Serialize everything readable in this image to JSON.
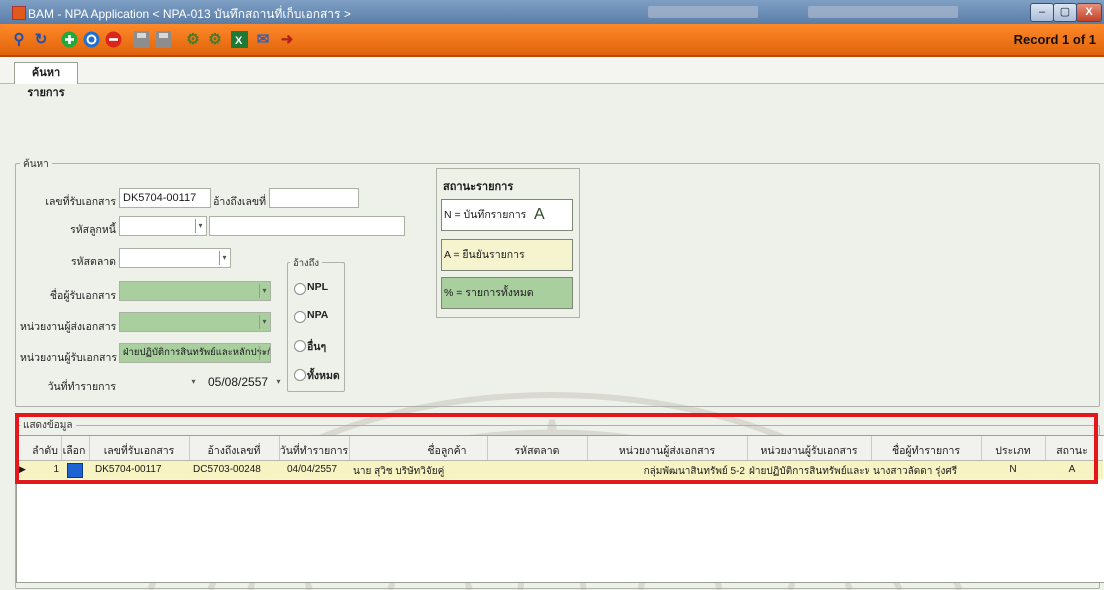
{
  "window": {
    "title": "BAM - NPA Application < NPA-013 บันทึกสถานที่เก็บเอกสาร >",
    "minimize": "–",
    "maximize": "▢",
    "close": "X"
  },
  "toolbar": {
    "icons": [
      "search-icon",
      "refresh-icon",
      "add-icon",
      "info-icon",
      "delete-icon",
      "save-icon",
      "save-all-icon",
      "settings-icon",
      "settings-cancel-icon",
      "excel-icon",
      "mail-icon",
      "exit-icon"
    ],
    "record_label": "Record 1 of 1"
  },
  "tabs": [
    {
      "label": "ค้นหารายการ"
    }
  ],
  "search": {
    "legend": "ค้นหา",
    "doc_no_label": "เลขที่รับเอกสาร",
    "doc_no_value": "DK5704-00117",
    "ref_no_label": "อ้างถึงเลขที่",
    "ref_no_value": "",
    "customer_code_label": "รหัสลูกหนี้",
    "market_code_label": "รหัสตลาด",
    "sender_label": "ชื่อผู้รับเอกสาร",
    "sender_unit_label": "หน่วยงานผู้ส่งเอกสาร",
    "receiver_unit_label": "หน่วยงานผู้รับเอกสาร",
    "receiver_unit_value": "ฝ่ายปฏิบัติการสินทรัพย์และหลักประกัน",
    "date_label": "วันที่ทำรายการ",
    "date_value": "05/08/2557"
  },
  "ref_type": {
    "legend": "อ้างถึง",
    "options": [
      "NPL",
      "NPA",
      "อื่นๆ",
      "ทั้งหมด"
    ]
  },
  "status": {
    "legend": "สถานะรายการ",
    "items": [
      {
        "label": "N = บันทึกรายการ",
        "value": "A"
      },
      {
        "label": "A = ยืนยันรายการ",
        "value": ""
      },
      {
        "label": "% = รายการทั้งหมด",
        "value": ""
      }
    ]
  },
  "results": {
    "legend": "แสดงข้อมูล",
    "columns": [
      "ลำดับ",
      "เลือก",
      "เลขที่รับเอกสาร",
      "อ้างถึงเลขที่",
      "วันที่ทำรายการ",
      "ชื่อลูกค้า",
      "รหัสตลาด",
      "หน่วยงานผู้ส่งเอกสาร",
      "หน่วยงานผู้รับเอกสาร",
      "ชื่อผู้ทำรายการ",
      "ประเภท",
      "สถานะ"
    ],
    "rows": [
      {
        "seq": "1",
        "doc_no": "DK5704-00117",
        "ref_no": "DC5703-00248",
        "date": "04/04/2557",
        "customer": "นาย สุวิช บริษัทวิจัยคู่",
        "market": "",
        "sender_unit": "กลุ่มพัฒนาสินทรัพย์ 5-2",
        "receiver_unit": "ฝ่ายปฏิบัติการสินทรัพย์และหลักประกัน",
        "operator": "นางสาวลัดดา รุ่งศรี",
        "type": "N",
        "status": "A"
      }
    ]
  },
  "colors": {
    "toolbar": "#f07316",
    "highlight": "#e3181c",
    "green_field": "#a9cf9f"
  }
}
